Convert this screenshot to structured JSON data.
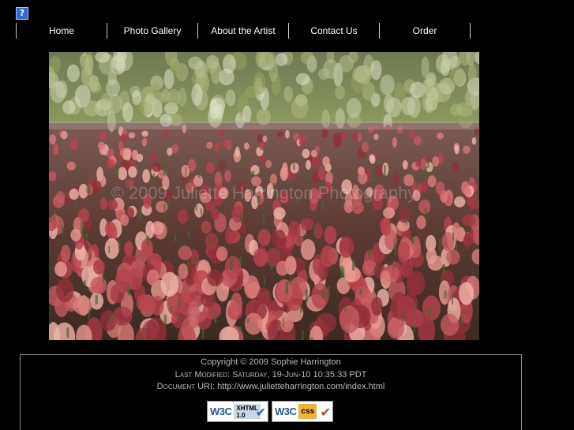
{
  "help_icon": {
    "name": "help-icon",
    "glyph": "?"
  },
  "nav": {
    "items": [
      {
        "label": "Home"
      },
      {
        "label": "Photo Gallery"
      },
      {
        "label": "About the Artist"
      },
      {
        "label": "Contact Us"
      },
      {
        "label": "Order"
      }
    ]
  },
  "photo": {
    "watermark": "© 2009 Juliette Harrington Photography"
  },
  "footer": {
    "copyright": "Copyright © 2009 Sophie Harrington",
    "last_modified_label": "Last Modified:",
    "last_modified_value": "Saturday, 19-Jun-10 10:35:33 PDT",
    "document_uri_label": "Document URI:",
    "document_uri_value": "http://www.julietteharrington.com/index.html"
  },
  "badges": {
    "xhtml": {
      "w3c": "W3C",
      "line1": "XHTML",
      "line2": "1.0",
      "check": "✔"
    },
    "css": {
      "w3c": "W3C",
      "line1": "css",
      "check": "✔"
    }
  },
  "colors": {
    "background": "#000000",
    "nav_text": "#ffffff",
    "footer_text": "#b9b9b9",
    "footer_border": "#8a8a8a"
  }
}
